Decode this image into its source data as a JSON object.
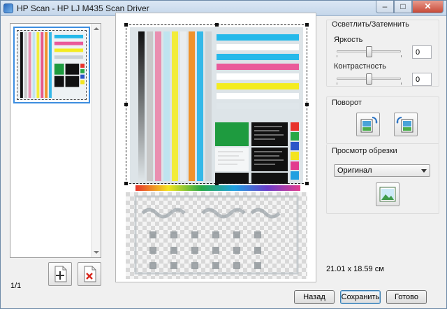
{
  "window": {
    "title": "HP Scan - HP LJ M435 Scan Driver"
  },
  "thumbnails": {
    "page_counter": "1/1"
  },
  "brightness": {
    "group_title": "Осветлить/Затемнить",
    "brightness_label": "Яркость",
    "brightness_value": "0",
    "contrast_label": "Контрастность",
    "contrast_value": "0"
  },
  "rotation": {
    "group_title": "Поворот"
  },
  "crop_preview": {
    "group_title": "Просмотр обрезки",
    "selected_option": "Оригинал"
  },
  "status": {
    "dimensions": "21.01 x 18.59 см"
  },
  "buttons": {
    "back": "Назад",
    "save": "Сохранить",
    "done": "Готово"
  },
  "icons": {
    "app": "hp-scan-icon",
    "add_page": "add-page-icon",
    "delete_page": "delete-page-icon",
    "rotate_left": "rotate-left-icon",
    "rotate_right": "rotate-right-icon",
    "crop_preview": "crop-preview-image-icon"
  },
  "colors": {
    "selection": "#3d8ee0",
    "close_button": "#c74a38",
    "target_bars": [
      "#111111",
      "#c8c8c8",
      "#e98fb0",
      "#bfe4ef",
      "#f2ec3a",
      "#e9edf0",
      "#e85a8a",
      "#f0922b",
      "#35b8e8",
      "#1b1b1b",
      "#cfd3d6"
    ],
    "stripes": [
      "#25b9ea",
      "#ffffff",
      "#ea5a9a",
      "#ffffff",
      "#f4ec20",
      "#dfe6ea"
    ],
    "swatches": [
      "#e8322b",
      "#27a846",
      "#2b56c8",
      "#f3e41f",
      "#e23b8f",
      "#1f9fe0",
      "#111111"
    ]
  }
}
